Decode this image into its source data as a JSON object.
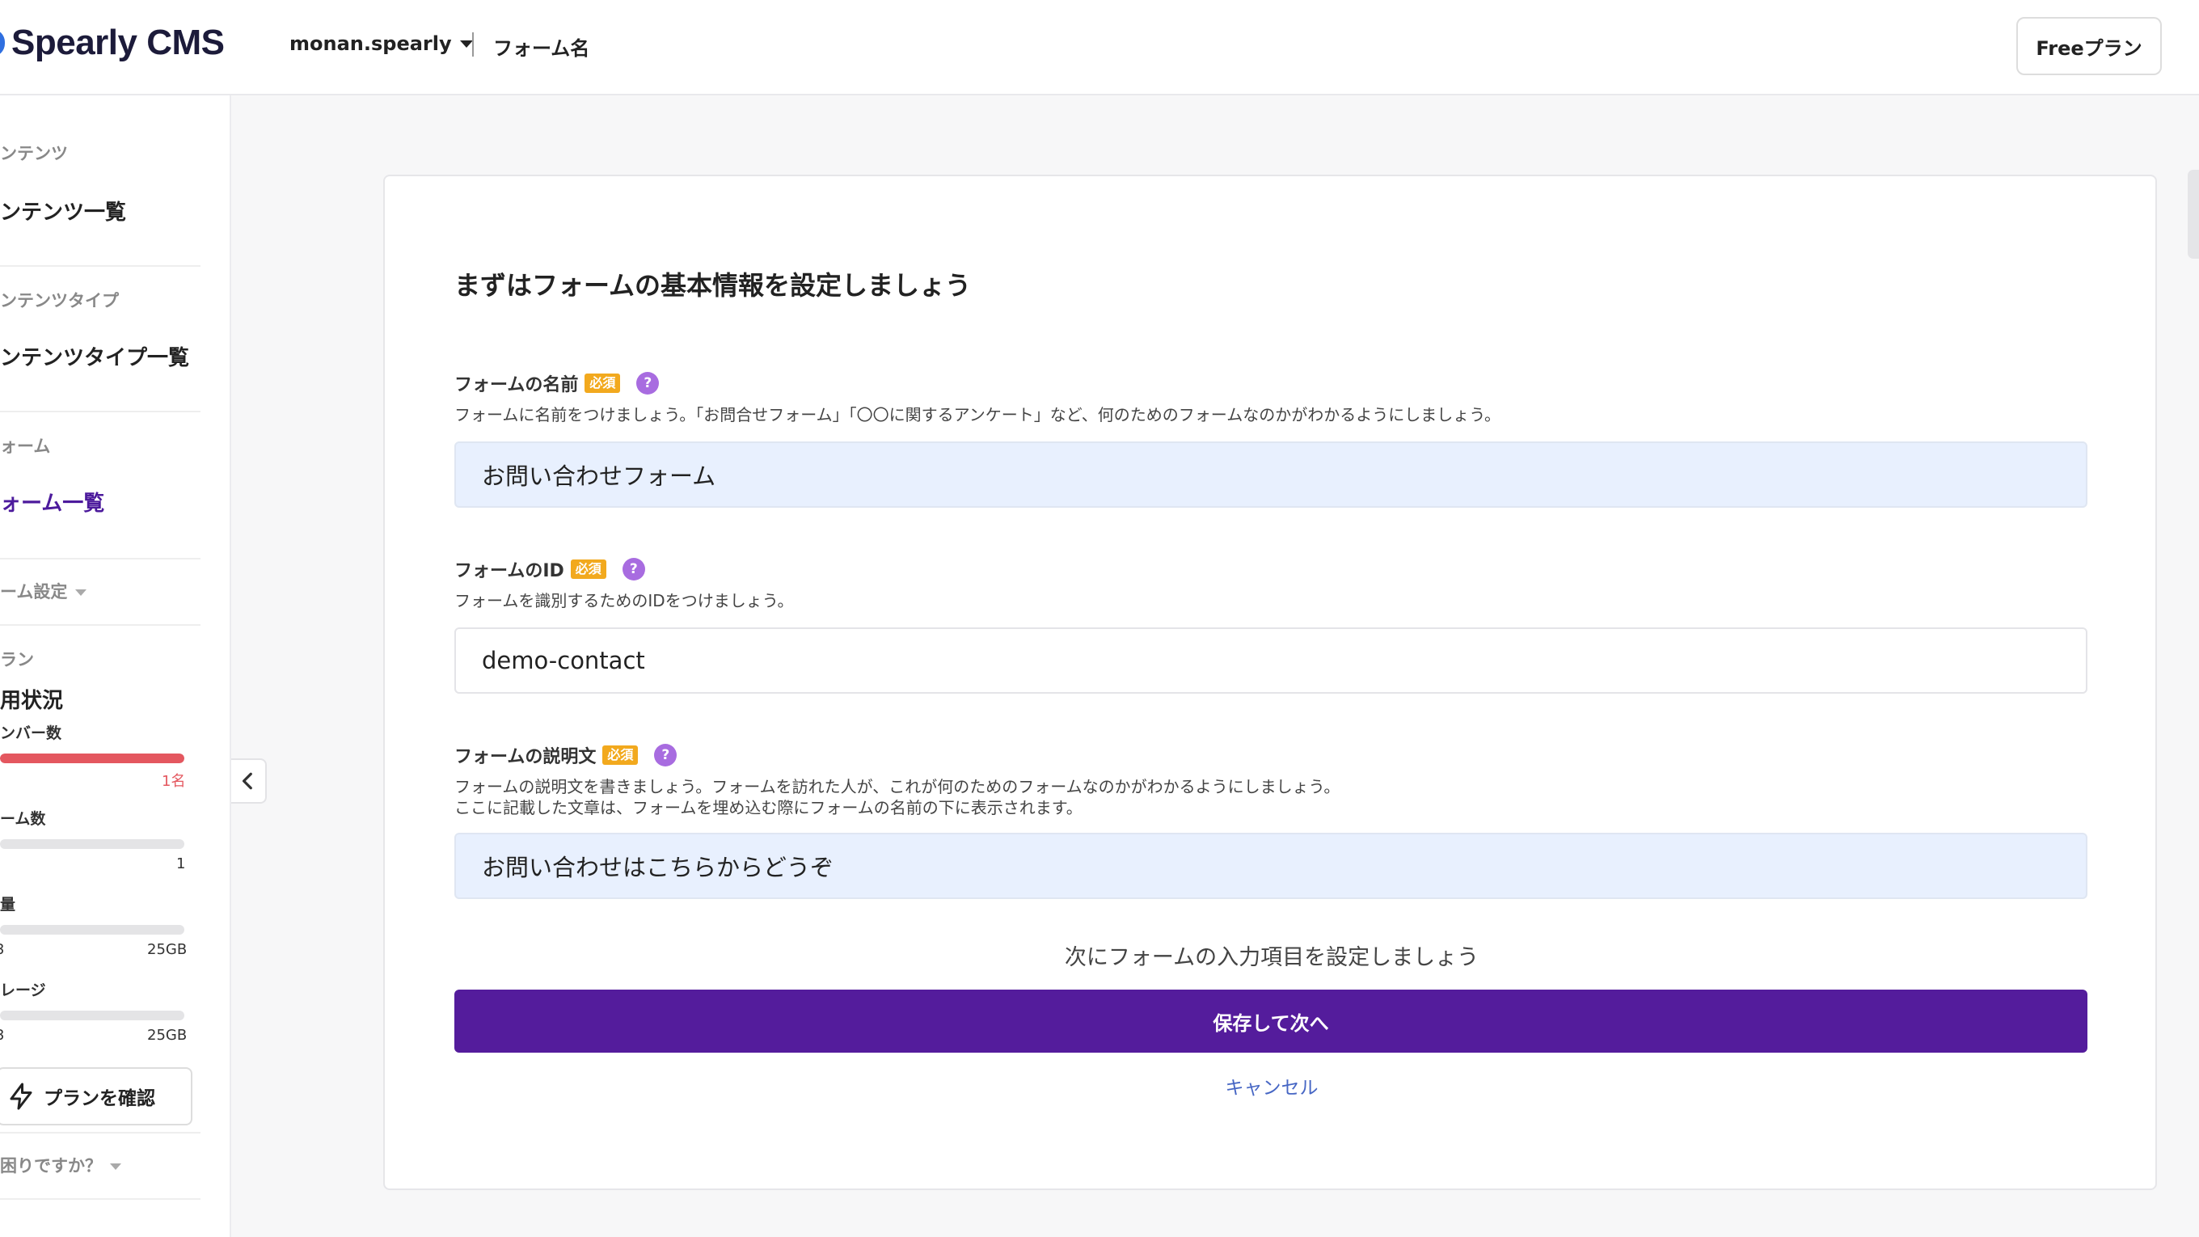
{
  "header": {
    "logo_text": "Spearly CMS",
    "account": "monan.spearly",
    "breadcrumb": "フォーム名",
    "plan_button": "Freeプラン"
  },
  "sidebar": {
    "content_section": "ンテンツ",
    "content_list": "ンテンツ一覧",
    "content_type_section": "ンテンツタイプ",
    "content_type_list": "ンテンツタイプ一覧",
    "form_section": "ォーム",
    "form_list": "ォーム一覧",
    "form_settings": "ーム設定",
    "plan_section": "ラン",
    "usage_title": "用状況",
    "members_label": "ンバー数",
    "members_value": "1名",
    "members_fraction": 1.0,
    "forms_label": "ーム数",
    "forms_value": "1",
    "capacity_label": "量",
    "capacity_left": "3",
    "capacity_value": "25GB",
    "storage_label": "レージ",
    "storage_left": "3",
    "storage_value": "25GB",
    "plan_check_button": "プランを確認",
    "help_menu": "困りですか？"
  },
  "form": {
    "title": "まずはフォームの基本情報を設定しましょう",
    "required_badge": "必須",
    "help_mark": "?",
    "name_label": "フォームの名前",
    "name_desc": "フォームに名前をつけましょう。「お問合せフォーム」「〇〇に関するアンケート」など、何のためのフォームなのかがわかるようにしましょう。",
    "name_value": "お問い合わせフォーム",
    "id_label": "フォームのID",
    "id_desc": "フォームを識別するためのIDをつけましょう。",
    "id_value": "demo-contact",
    "desc_label": "フォームの説明文",
    "desc_desc_1": "フォームの説明文を書きましょう。フォームを訪れた人が、これが何のためのフォームなのかがわかるようにしましょう。",
    "desc_desc_2": "ここに記載した文章は、フォームを埋め込む際にフォームの名前の下に表示されます。",
    "desc_value": "お問い合わせはこちらからどうぞ",
    "next_hint": "次にフォームの入力項目を設定しましょう",
    "submit_label": "保存して次へ",
    "cancel_label": "キャンセル"
  },
  "colors": {
    "accent": "#541c9c",
    "required": "#f2a91e",
    "help": "#a86ce0",
    "usage_bar": "#e4575f"
  }
}
